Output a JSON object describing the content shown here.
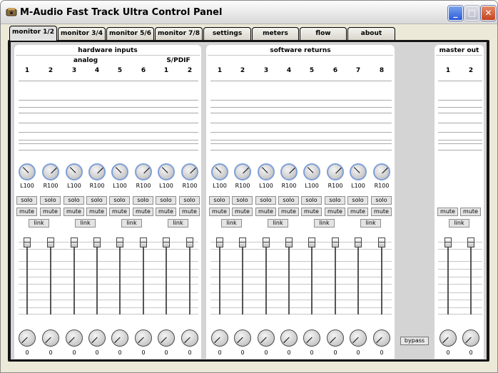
{
  "window": {
    "title": "M-Audio Fast Track Ultra Control Panel"
  },
  "tabs": [
    "monitor 1/2",
    "monitor 3/4",
    "monitor 5/6",
    "monitor 7/8",
    "settings",
    "meters",
    "flow",
    "about"
  ],
  "active_tab": "monitor 1/2",
  "hardware": {
    "title": "hardware inputs",
    "analog_label": "analog",
    "spdif_label": "S/PDIF",
    "channels": [
      "1",
      "2",
      "3",
      "4",
      "5",
      "6",
      "1",
      "2"
    ],
    "pan": [
      "L100",
      "R100",
      "L100",
      "R100",
      "L100",
      "R100",
      "L100",
      "R100"
    ],
    "solo": [
      "solo",
      "solo",
      "solo",
      "solo",
      "solo",
      "solo",
      "solo",
      "solo"
    ],
    "mute": [
      "mute",
      "mute",
      "mute",
      "mute",
      "mute",
      "mute",
      "mute",
      "mute"
    ],
    "link": [
      "link",
      "link",
      "link",
      "link"
    ],
    "values": [
      "0",
      "0",
      "0",
      "0",
      "0",
      "0",
      "0",
      "0"
    ]
  },
  "software": {
    "title": "software returns",
    "channels": [
      "1",
      "2",
      "3",
      "4",
      "5",
      "6",
      "7",
      "8"
    ],
    "pan": [
      "L100",
      "R100",
      "L100",
      "R100",
      "L100",
      "R100",
      "L100",
      "R100"
    ],
    "solo": [
      "solo",
      "solo",
      "solo",
      "solo",
      "solo",
      "solo",
      "solo",
      "solo"
    ],
    "mute": [
      "mute",
      "mute",
      "mute",
      "mute",
      "mute",
      "mute",
      "mute",
      "mute"
    ],
    "link": [
      "link",
      "link",
      "link",
      "link"
    ],
    "values": [
      "0",
      "0",
      "0",
      "0",
      "0",
      "0",
      "0",
      "0"
    ]
  },
  "master": {
    "title": "master out",
    "channels": [
      "1",
      "2"
    ],
    "mute": [
      "mute",
      "mute"
    ],
    "link": "link",
    "values": [
      "0",
      "0"
    ]
  },
  "bypass_label": "bypass",
  "colors": {
    "pan_knob_ring": "#7f9fd6",
    "frame": "#151515",
    "panel": "#d4d4d4"
  }
}
